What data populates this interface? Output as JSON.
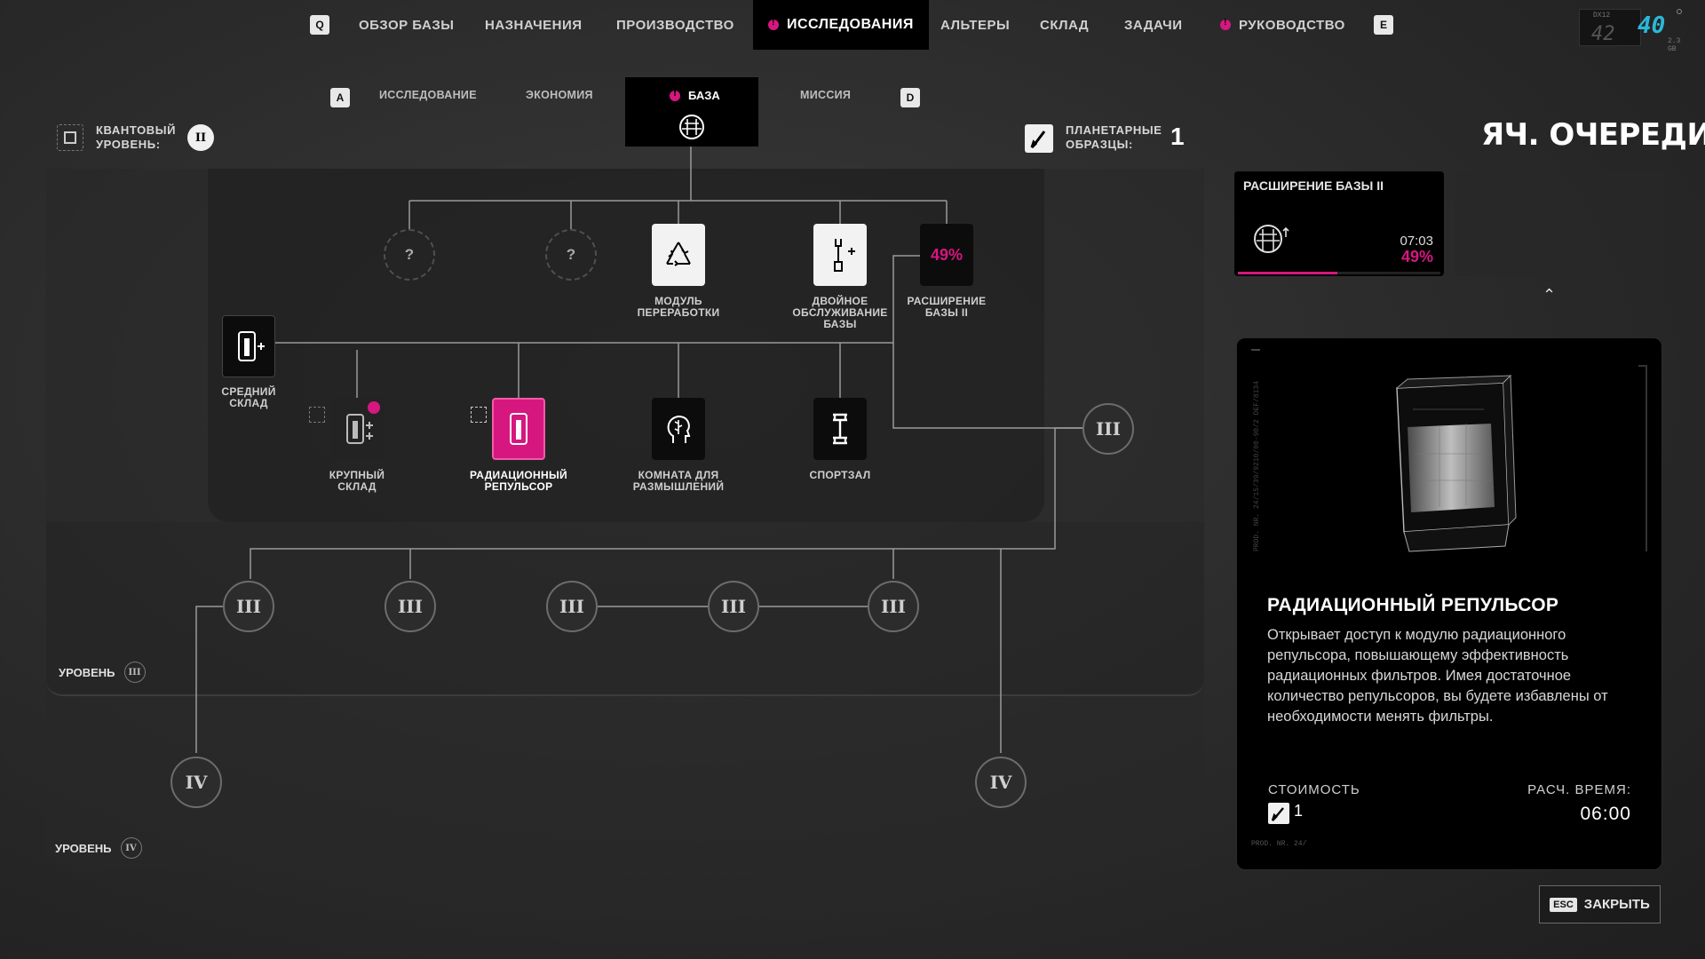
{
  "topnav": {
    "prev_key": "Q",
    "next_key": "E",
    "items": [
      {
        "label": "ОБЗОР БАЗЫ"
      },
      {
        "label": "НАЗНАЧЕНИЯ"
      },
      {
        "label": "ПРОИЗВОДСТВО"
      },
      {
        "label": "ИССЛЕДОВАНИЯ",
        "active": true,
        "alert": true
      },
      {
        "label": "АЛЬТЕРЫ"
      },
      {
        "label": "СКЛАД"
      },
      {
        "label": "ЗАДАЧИ"
      },
      {
        "label": "РУКОВОДСТВО",
        "alert": true
      }
    ]
  },
  "hud": {
    "code": "DX12",
    "fps": "40",
    "gpu": "42",
    "mem": "2.3 GB"
  },
  "subtabs": {
    "prev_key": "A",
    "next_key": "D",
    "items": [
      {
        "label": "ИССЛЕДОВАНИЕ"
      },
      {
        "label": "ЭКОНОМИЯ"
      },
      {
        "label": "БАЗА",
        "active": true
      },
      {
        "label": "МИССИЯ"
      }
    ]
  },
  "quantum": {
    "label_line1": "КВАНТОВЫЙ",
    "label_line2": "УРОВЕНЬ:",
    "value": "II"
  },
  "samples": {
    "label_line1": "ПЛАНЕТАРНЫЕ",
    "label_line2": "ОБРАЗЦЫ:",
    "value": "1"
  },
  "tree": {
    "unknown_mark": "?",
    "progress_node_value": "49%",
    "nodes": {
      "recycling": {
        "line1": "МОДУЛЬ",
        "line2": "ПЕРЕРАБОТКИ"
      },
      "dual_service": {
        "line1": "ДВОЙНОЕ",
        "line2": "ОБСЛУЖИВАНИЕ",
        "line3": "БАЗЫ"
      },
      "expansion": {
        "line1": "РАСШИРЕНИЕ",
        "line2": "БАЗЫ II"
      },
      "medium_storage": {
        "line1": "СРЕДНИЙ",
        "line2": "СКЛАД"
      },
      "large_storage": {
        "line1": "КРУПНЫЙ",
        "line2": "СКЛАД"
      },
      "rad_repulsor": {
        "line1": "РАДИАЦИОННЫЙ",
        "line2": "РЕПУЛЬСОР"
      },
      "meditation": {
        "line1": "КОМНАТА ДЛЯ",
        "line2": "РАЗМЫШЛЕНИЙ"
      },
      "gym": {
        "line1": "СПОРТЗАЛ"
      }
    },
    "tier3": "III",
    "tier4": "IV",
    "level3_label": "УРОВЕНЬ",
    "level3_badge": "III",
    "level4_label": "УРОВЕНЬ",
    "level4_badge": "IV"
  },
  "queue": {
    "title": "ЯЧ. ОЧЕРЕДИ",
    "card": {
      "name": "РАСШИРЕНИЕ БАЗЫ II",
      "time": "07:03",
      "percent": "49%",
      "progress": 0.49
    },
    "collapse_glyph": "⌃"
  },
  "detail": {
    "title": "РАДИАЦИОННЫЙ РЕПУЛЬСОР",
    "description": "Открывает доступ к модулю радиационного репульсора, повышающему эффективность радиационных фильтров. Имея достаточное количество репульсоров, вы будете избавлены от необходимости менять фильтры.",
    "cost_label": "СТОИМОСТЬ",
    "cost_value": "1",
    "time_label": "РАСЧ. ВРЕМЯ:",
    "time_value": "06:00",
    "prod_code": "PROD. NR. 24/",
    "side_code": "PROD. NR. 24/15/39/9210/00-90/2 DEF/8134"
  },
  "close": {
    "key": "ESC",
    "label": "ЗАКРЫТЬ"
  },
  "colors": {
    "accent": "#d6177f",
    "panel": "#000000",
    "background": "#2a2a2a"
  }
}
